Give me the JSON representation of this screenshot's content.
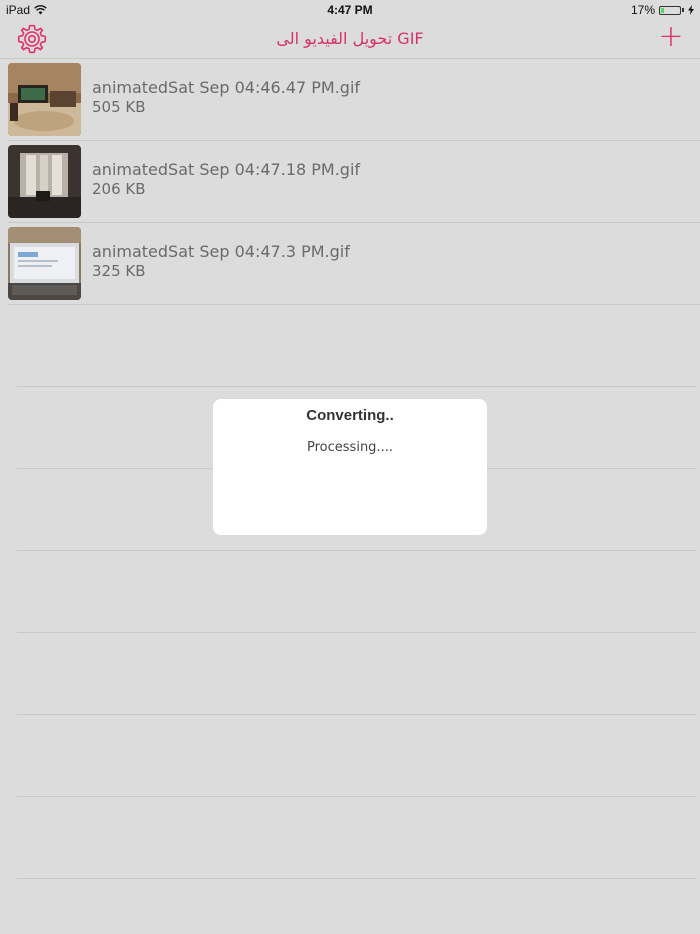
{
  "status_bar": {
    "device": "iPad",
    "time": "4:47 PM",
    "battery_percent": "17%",
    "battery_level": 0.17
  },
  "nav": {
    "title": "تحويل الفيديو الى GIF",
    "settings_icon": "gear-icon",
    "add_label": "+"
  },
  "files": [
    {
      "name": "animatedSat Sep 04:46.47 PM.gif",
      "size": "505 KB"
    },
    {
      "name": "animatedSat Sep 04:47.18 PM.gif",
      "size": "206 KB"
    },
    {
      "name": "animatedSat Sep 04:47.3 PM.gif",
      "size": "325 KB"
    }
  ],
  "alert": {
    "title": "Converting..",
    "message": "Processing...."
  },
  "colors": {
    "accent": "#e0306a",
    "background": "#dcdcdc"
  }
}
